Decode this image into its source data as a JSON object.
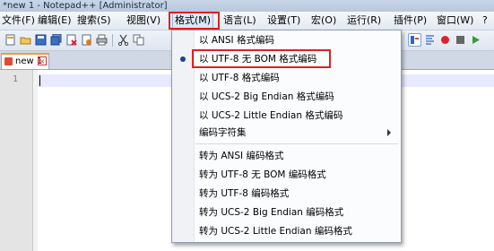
{
  "window": {
    "title": "*new 1 - Notepad++ [Administrator]"
  },
  "menubar": {
    "items": [
      {
        "label": "文件(F)"
      },
      {
        "label": "编辑(E)"
      },
      {
        "label": "搜索(S)"
      },
      {
        "label": "视图(V)"
      },
      {
        "label": "格式(M)"
      },
      {
        "label": "语言(L)"
      },
      {
        "label": "设置(T)"
      },
      {
        "label": "宏(O)"
      },
      {
        "label": "运行(R)"
      },
      {
        "label": "插件(P)"
      },
      {
        "label": "窗口(W)"
      },
      {
        "label": "?"
      }
    ]
  },
  "tabs": [
    {
      "label": "new 1",
      "close": "×"
    }
  ],
  "editor": {
    "line_numbers": [
      "1"
    ]
  },
  "format_menu": {
    "items": [
      {
        "label": "以 ANSI 格式编码"
      },
      {
        "label": "以 UTF-8 无 BOM 格式编码",
        "checked": true
      },
      {
        "label": "以 UTF-8 格式编码"
      },
      {
        "label": "以 UCS-2 Big Endian 格式编码"
      },
      {
        "label": "以 UCS-2 Little Endian 格式编码"
      },
      {
        "label": "编码字符集"
      },
      {
        "label": "转为 ANSI 编码格式"
      },
      {
        "label": "转为 UTF-8 无 BOM 编码格式"
      },
      {
        "label": "转为 UTF-8 编码格式"
      },
      {
        "label": "转为 UCS-2 Big Endian 编码格式"
      },
      {
        "label": "转为 UCS-2 Little Endian 编码格式"
      }
    ]
  },
  "colors": {
    "highlight_box": "#e02020",
    "current_line": "#e8e8ff",
    "radio_dot": "#1f3f8a"
  }
}
